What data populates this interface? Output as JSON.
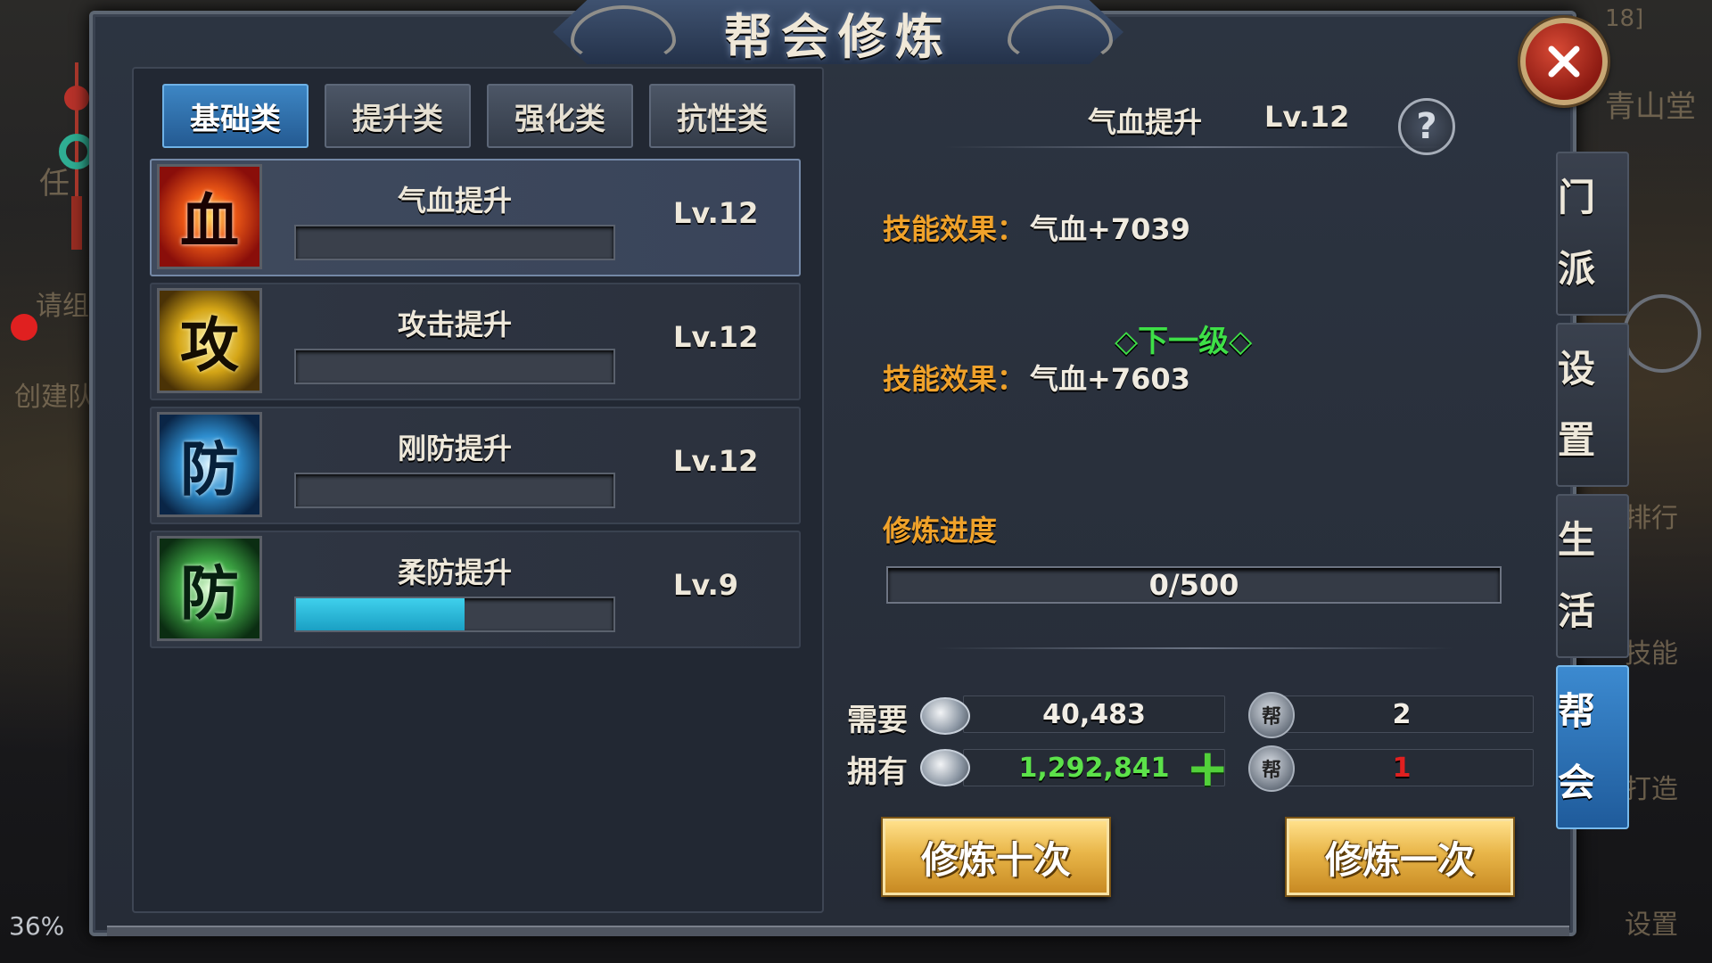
{
  "window": {
    "title": "帮会修炼",
    "close_icon": "close-icon"
  },
  "background": {
    "left_texts": [
      "任",
      "请组",
      "创建队"
    ],
    "right_texts": [
      "青山堂",
      "排行",
      "技能",
      "打造",
      "设置"
    ],
    "top_right_text": "18]",
    "percent": "36%"
  },
  "tabs": [
    {
      "label": "基础类",
      "active": true
    },
    {
      "label": "提升类",
      "active": false
    },
    {
      "label": "强化类",
      "active": false
    },
    {
      "label": "抗性类",
      "active": false
    }
  ],
  "skills": [
    {
      "icon_char": "血",
      "icon": "blood-icon",
      "name": "气血提升",
      "level": "Lv.12",
      "progress": 0,
      "selected": true
    },
    {
      "icon_char": "攻",
      "icon": "attack-icon",
      "name": "攻击提升",
      "level": "Lv.12",
      "progress": 0,
      "selected": false
    },
    {
      "icon_char": "防",
      "icon": "defense-icon",
      "name": "刚防提升",
      "level": "Lv.12",
      "progress": 0,
      "selected": false
    },
    {
      "icon_char": "防",
      "icon": "soft-defense-icon",
      "name": "柔防提升",
      "level": "Lv.9",
      "progress": 0.53,
      "selected": false
    }
  ],
  "detail": {
    "title": "气血提升",
    "level": "Lv.12",
    "help_glyph": "?",
    "effect_label": "技能效果：",
    "current_effect": "气血+7039",
    "next_level_label": "◇下一级◇",
    "next_effect": "气血+7603",
    "progress_label": "修炼进度",
    "progress_text": "0/500"
  },
  "cost": {
    "need_label": "需要",
    "have_label": "拥有",
    "need_silver": "40,483",
    "have_silver": "1,292,841",
    "need_token": "2",
    "have_token": "1",
    "plus_glyph": "+",
    "token_glyph": "帮"
  },
  "buttons": {
    "train_ten": "修炼十次",
    "train_once": "修炼一次"
  },
  "side_nav": [
    {
      "label": "门派",
      "active": false
    },
    {
      "label": "设置",
      "active": false
    },
    {
      "label": "生活",
      "active": false
    },
    {
      "label": "帮会",
      "active": true
    }
  ],
  "colors": {
    "accent_orange": "#f0a22a",
    "next_level_green": "#3ee047",
    "own_silver_green": "#5ce24a",
    "token_shortfall_red": "#e02020",
    "progress_cyan": "#2cc0e0",
    "tab_active_blue": "#3d86c4"
  }
}
